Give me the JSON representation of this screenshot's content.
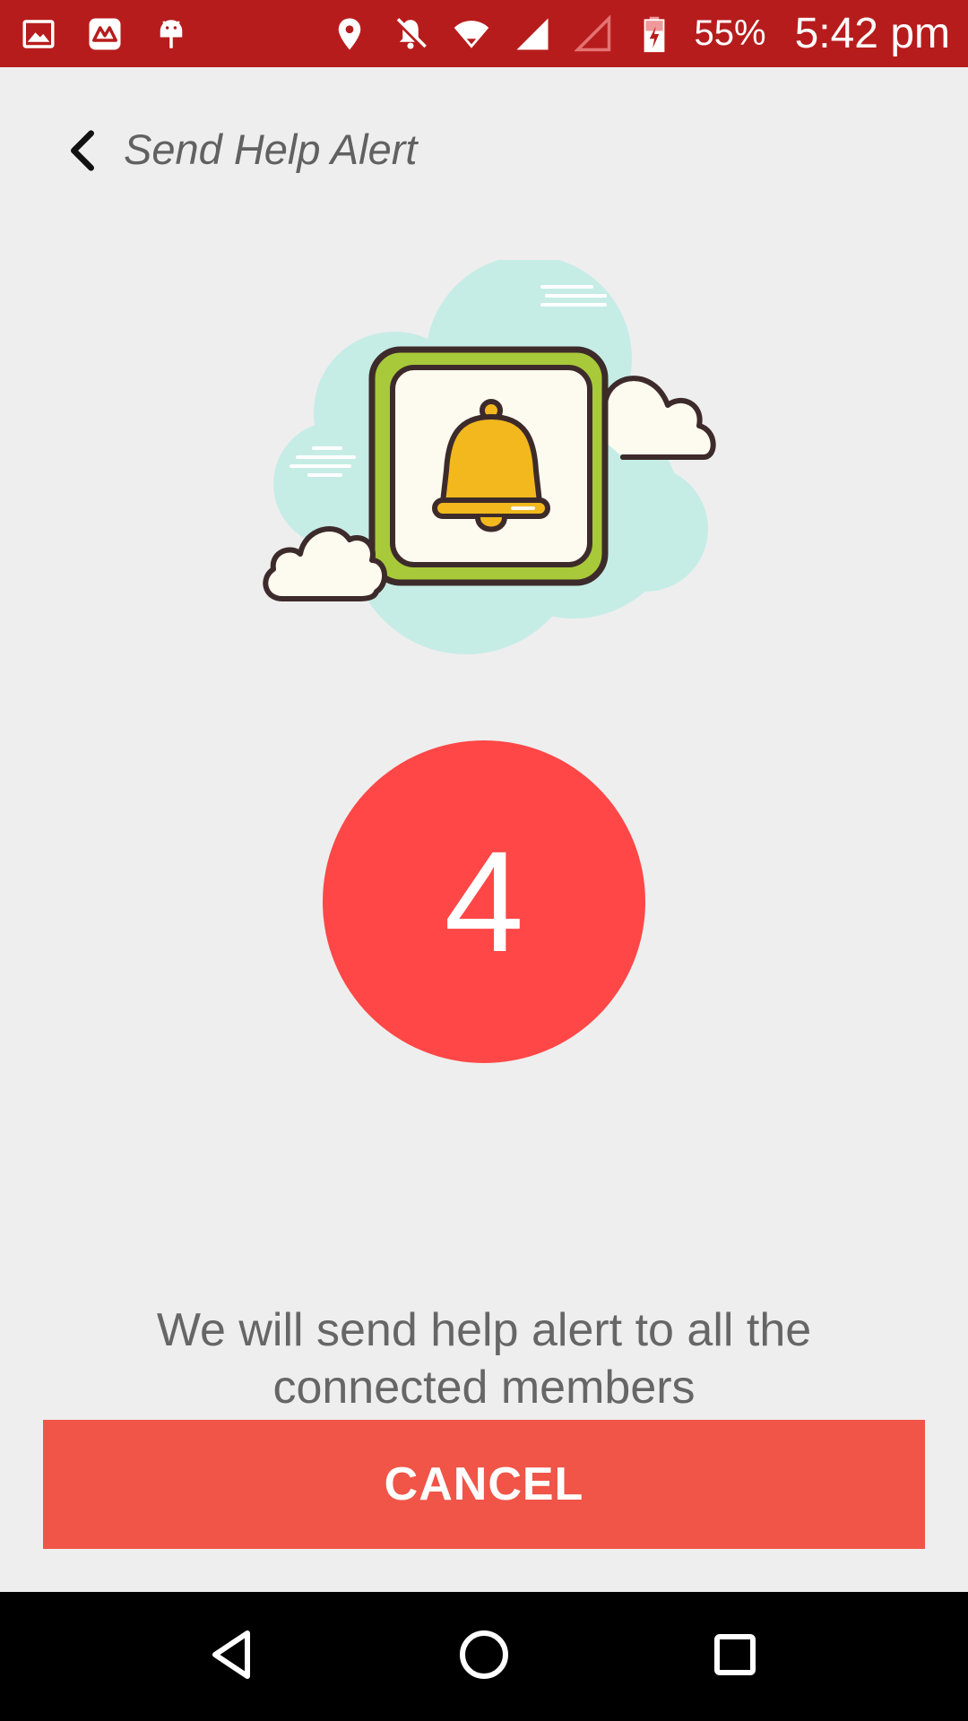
{
  "status_bar": {
    "left_icons": [
      "gallery-icon",
      "app-notification-icon",
      "android-debug-icon"
    ],
    "right_icons": [
      "location-icon",
      "notifications-off-icon",
      "wifi-icon",
      "signal-icon",
      "signal-empty-icon",
      "battery-charging-icon"
    ],
    "battery_percent": "55%",
    "time": "5:42 pm",
    "background_color": "#b71c1c"
  },
  "header": {
    "back_icon": "chevron-left-icon",
    "title": "Send Help Alert"
  },
  "illustration": {
    "icon": "bell-alert-illustration"
  },
  "countdown": {
    "value": "4",
    "color": "#ff4747"
  },
  "message": {
    "text": "We will send help alert to all the connected members"
  },
  "cancel_button": {
    "label": "CANCEL",
    "color": "#f05548"
  },
  "nav_bar": {
    "buttons": [
      "back-triangle-icon",
      "home-circle-icon",
      "recents-square-icon"
    ]
  }
}
